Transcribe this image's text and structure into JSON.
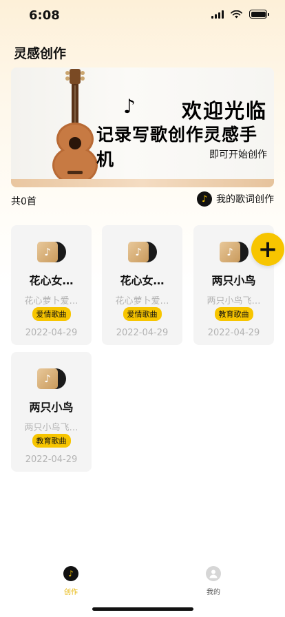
{
  "status": {
    "time": "6:08"
  },
  "header": {
    "title": "灵感创作"
  },
  "banner": {
    "headline": "欢迎光临",
    "subheadline": "记录写歌创作灵感手机",
    "caption": "即可开始创作",
    "note_icon": "music-note-icon"
  },
  "summary": {
    "count_label": "共0首",
    "my_lyrics_label": "我的歌词创作"
  },
  "songs": [
    {
      "title": "花心女…",
      "desc": "花心萝卜爱…",
      "tag": "爱情歌曲",
      "date": "2022-04-29"
    },
    {
      "title": "花心女…",
      "desc": "花心萝卜爱…",
      "tag": "爱情歌曲",
      "date": "2022-04-29"
    },
    {
      "title": "两只小鸟",
      "desc": "两只小鸟飞…",
      "tag": "教育歌曲",
      "date": "2022-04-29"
    },
    {
      "title": "两只小鸟",
      "desc": "两只小鸟飞…",
      "tag": "教育歌曲",
      "date": "2022-04-29"
    }
  ],
  "fab": {
    "label": "+"
  },
  "tabs": [
    {
      "label": "创作",
      "icon": "music-disc-icon",
      "active": true
    },
    {
      "label": "我的",
      "icon": "user-icon",
      "active": false
    }
  ],
  "colors": {
    "accent": "#f7c500",
    "card_bg": "#f4f4f4",
    "muted_text": "#b3b3b3"
  }
}
